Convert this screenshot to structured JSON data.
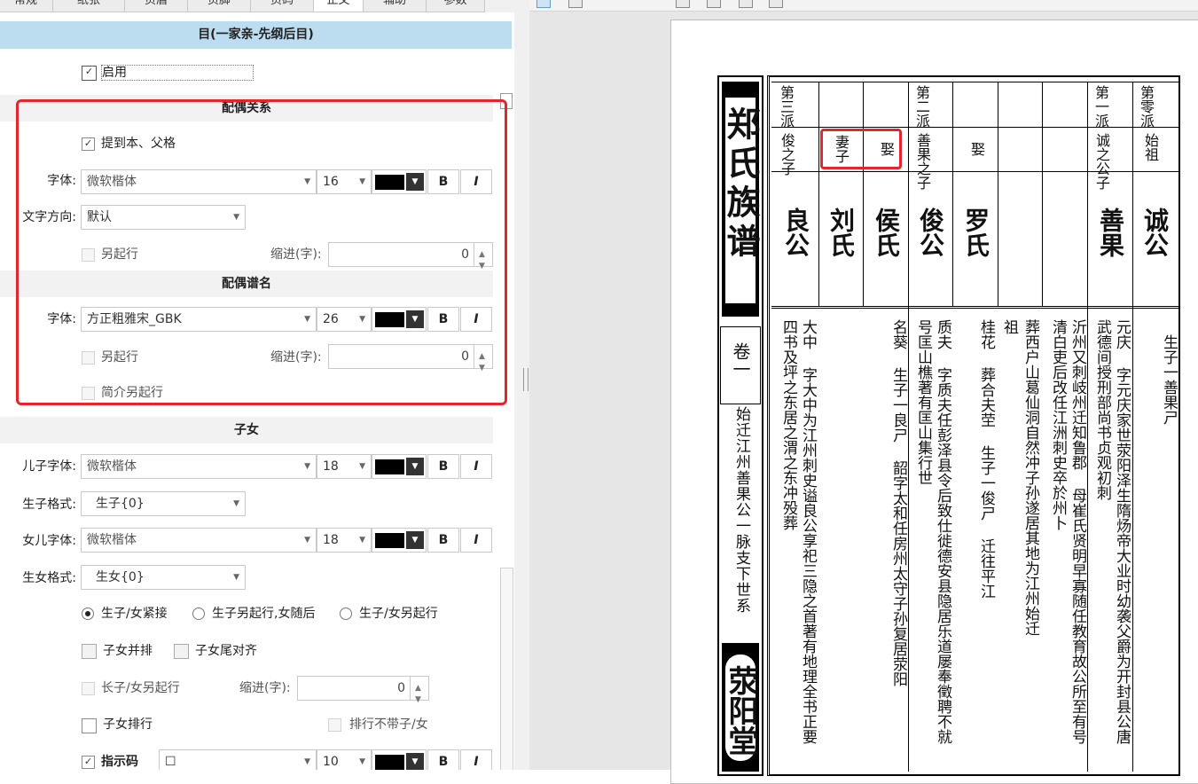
{
  "tabs": [
    "常规",
    "纸张",
    "页眉",
    "页脚",
    "页码",
    "正文",
    "辅助",
    "参数"
  ],
  "section_header": "目(一家亲-先纲后目)",
  "enable_label": "启用",
  "spouse": {
    "title": "配偶关系",
    "raise_label": "提到本、父格",
    "font_label": "字体:",
    "font_value": "微软楷体",
    "size_value": "16",
    "dir_label": "文字方向:",
    "dir_value": "默认",
    "newline_label": "另起行",
    "indent_label": "缩进(字):",
    "indent_value": "0"
  },
  "spouse_name": {
    "title": "配偶谱名",
    "font_label": "字体:",
    "font_value": "方正粗雅宋_GBK",
    "size_value": "26",
    "newline_label": "另起行",
    "indent_label": "缩进(字):",
    "indent_value": "0",
    "intro_newline_label": "简介另起行"
  },
  "children": {
    "title": "子女",
    "son_font_label": "儿子字体:",
    "son_font_value": "微软楷体",
    "son_size_value": "18",
    "son_fmt_label": "生子格式:",
    "son_fmt_value": "生子{0}",
    "dau_font_label": "女儿字体:",
    "dau_font_value": "微软楷体",
    "dau_size_value": "18",
    "dau_fmt_label": "生女格式:",
    "dau_fmt_value": "生女{0}",
    "radio1": "生子/女紧接",
    "radio2": "生子另起行,女随后",
    "radio3": "生子/女另起行",
    "parallel_label": "子女并排",
    "tail_align_label": "子女尾对齐",
    "eldest_label": "长子/女另起行",
    "indent_label": "缩进(字):",
    "indent_value": "0",
    "rank_label": "子女排行",
    "rank_no_label": "排行不带子/女",
    "marker_label": "指示码",
    "marker_value": "☐",
    "marker_size": "10"
  },
  "bold_btn": "B",
  "italic_btn": "I",
  "preview": {
    "book_title": "郑氏族谱",
    "volume": "卷一",
    "lineage": "始迁江州善果公一脉支下世系",
    "hall": "荥阳堂",
    "generations": [
      "第零派",
      "第一派",
      "",
      "",
      "",
      "第二派",
      "",
      "",
      "第三派"
    ],
    "relations": [
      "始祖",
      "诚之公子",
      "",
      "",
      "娶",
      "善果之子",
      "娶",
      "妻子",
      "俊之子"
    ],
    "names": [
      "诚公",
      "善果",
      "",
      "",
      "罗氏",
      "俊公",
      "侯氏",
      "刘氏",
      "良公"
    ],
    "bios": [
      "　生子一善果ㄕ",
      "元庆 字元庆家世荥阳泽生隋炀帝大业时幼袭父爵为开封县公唐武德间授刑部尚书贞观初刺",
      "沂州又刺岐州迁知鲁郡 母崔氏贤明早寡随任教育故公所至有号清白吏后改任江洲刺史卒於州卜",
      "葬西户山葛仙洞自然冲子孙遂居其地为江州始迁",
      "祖",
      "桂花 葬合夫茔 生子一俊ㄕ 迁往平江",
      "质夫 字质夫任彭泽县令后致仕徙德安县隐居乐道屡奉徵聘不就号匡山樵著有匡山集行世",
      "名葵 生子一良ㄕ 韶字太和任房州太守子孙复居荥阳",
      "",
      "大中 字大中为江州刺史谥良公享祀三隐之首著有地理全书正要四书及坪之东居之渭之东冲殁葬"
    ]
  }
}
